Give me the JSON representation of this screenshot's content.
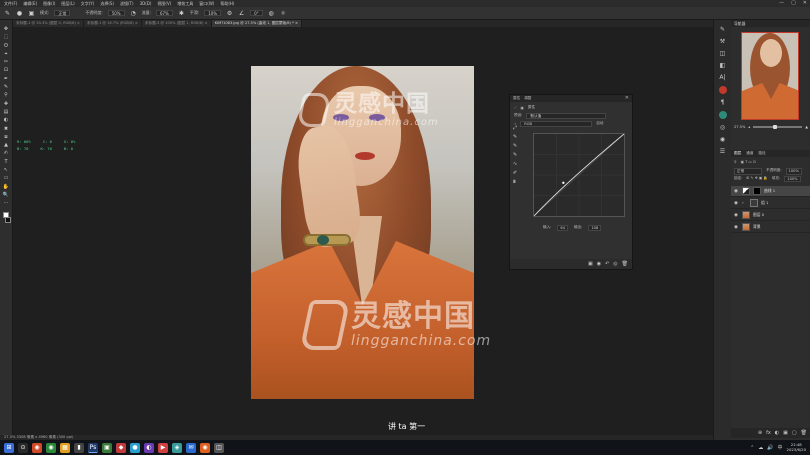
{
  "app": {
    "menus": [
      "文件(F)",
      "编辑(E)",
      "图像(I)",
      "图层(L)",
      "文字(Y)",
      "选择(S)",
      "滤镜(T)",
      "3D(D)",
      "视图(V)",
      "增效工具",
      "窗口(W)",
      "帮助(H)"
    ],
    "window_controls": [
      "—",
      "▢",
      "✕"
    ]
  },
  "options_bar": {
    "mode_label": "模式:",
    "mode_value": "正常",
    "opacity_label": "不透明度:",
    "opacity_value": "50%",
    "flow_label": "流量:",
    "flow_value": "67%",
    "smooth_label": "平滑:",
    "smooth_value": "10%",
    "angle_value": "0°"
  },
  "tabs": [
    {
      "label": "未标题-1 @ 33.3% (图层 0, RGB/8) ×",
      "active": false
    },
    {
      "label": "未标题-1 @ 16.7% (RGB/8) ×",
      "active": false
    },
    {
      "label": "未标题-3 @ 100% (图层 1, RGB/8) ×",
      "active": false
    },
    {
      "label": "KIM?1063.jpg @ 27.5% (曲线 1, 图层蒙版/8) * ×",
      "active": true
    }
  ],
  "tools": [
    "✥",
    "⬚",
    "ʘ",
    "⌖",
    "✂",
    "⊡",
    "✒",
    "✎",
    "⚲",
    "✚",
    "▤",
    "◐",
    "✖",
    "⧈",
    "▲",
    "✍",
    "T",
    "↖",
    "▭",
    "✋",
    "🔍",
    "⋯"
  ],
  "info_readout": {
    "rows": [
      {
        "a": "R: 66%",
        "b": "C: 0",
        "c": "G: 0%"
      },
      {
        "a": "B: 70",
        "b": "K: 70",
        "c": "B: 0"
      }
    ]
  },
  "watermark": {
    "cn": "灵感中国",
    "en": "lingganchina.com"
  },
  "caption": "讲 ta 第一",
  "curves_panel": {
    "header_tabs": [
      "属性",
      "调整"
    ],
    "preset_label": "预设:",
    "preset_value": "默认值",
    "channel_value": "RGB",
    "auto_button": "自动",
    "input_label": "输入:",
    "input_value": "64",
    "output_label": "输出:",
    "output_value": "108",
    "close": "✕",
    "tools": [
      "⤢",
      "✎",
      "✎",
      "✎",
      "∿",
      "✐",
      "⩩"
    ],
    "footer_icons": [
      "▣",
      "◉",
      "↶",
      "◎",
      "🗑"
    ]
  },
  "right_dock": {
    "icons": [
      "✎",
      "⚒",
      "◫",
      "◧",
      "A|",
      "¶",
      "◎",
      "◉",
      "☰"
    ]
  },
  "navigator": {
    "tab": "导航器",
    "zoom": "27.5%"
  },
  "layers_panel": {
    "tabs": [
      "图层",
      "通道",
      "路径"
    ],
    "blend_mode": "正常",
    "opacity_label": "不透明度:",
    "opacity_value": "100%",
    "fill_label": "填充:",
    "fill_value": "100%",
    "lock_label": "锁定:",
    "layers": [
      {
        "name": "曲线 1",
        "type": "adj",
        "active": true
      },
      {
        "name": "组 1",
        "type": "grp",
        "active": false
      },
      {
        "name": "图层 0",
        "type": "img",
        "active": false
      },
      {
        "name": "背景",
        "type": "img",
        "active": false
      }
    ],
    "footer_icons": [
      "⊕",
      "fx",
      "◐",
      "▣",
      "▢",
      "🗑"
    ]
  },
  "status_bar": "27.5%    3308 像素 x 4960 像素 (300 ppi)",
  "taskbar": {
    "icons": [
      {
        "g": "⊞",
        "c": "#3b6fd6"
      },
      {
        "g": "⊙",
        "c": "#2a2a2a"
      },
      {
        "g": "◉",
        "c": "#d04a2a"
      },
      {
        "g": "◉",
        "c": "#2a8a3a"
      },
      {
        "g": "▦",
        "c": "#e0a020"
      },
      {
        "g": "▮",
        "c": "#444"
      },
      {
        "g": "Ps",
        "c": "#1f3a6a"
      },
      {
        "g": "▣",
        "c": "#3a7a3a"
      },
      {
        "g": "◆",
        "c": "#c23a3a"
      },
      {
        "g": "●",
        "c": "#2aa0d0"
      },
      {
        "g": "◐",
        "c": "#6a3ab0"
      },
      {
        "g": "▶",
        "c": "#d04040"
      },
      {
        "g": "◈",
        "c": "#3a9a9a"
      },
      {
        "g": "✉",
        "c": "#2a6ad0"
      },
      {
        "g": "◉",
        "c": "#e06020"
      },
      {
        "g": "◫",
        "c": "#555"
      }
    ],
    "tray_icons": [
      "⌃",
      "☁",
      "🔊",
      "中"
    ],
    "clock_time": "22:48",
    "clock_date": "2023/6/20"
  }
}
